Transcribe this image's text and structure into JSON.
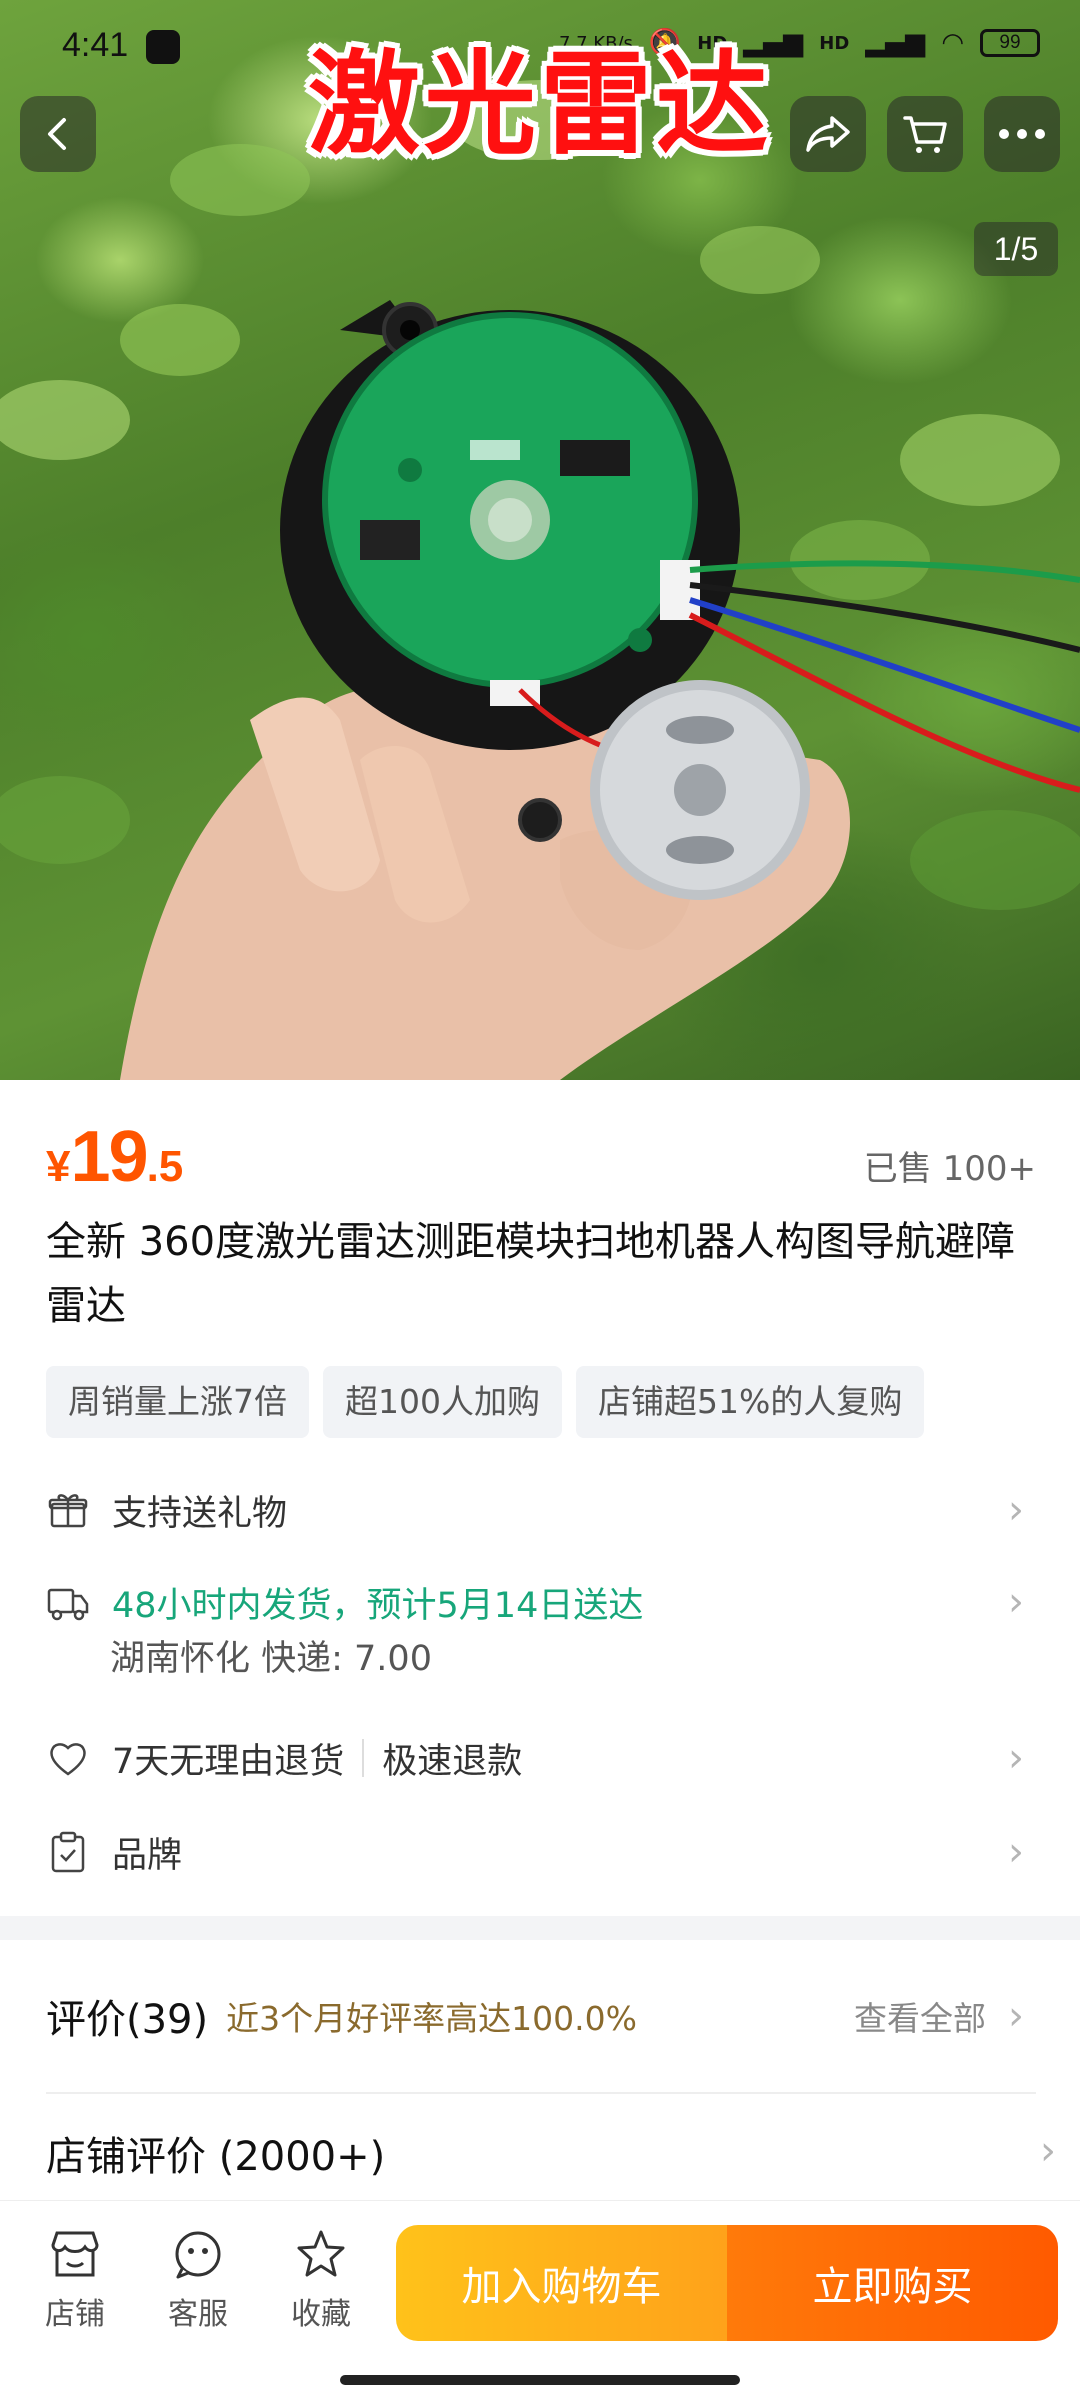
{
  "status_bar": {
    "time": "4:41",
    "battery": "99",
    "network_speed": "7.7 KB/s",
    "signal_labels": [
      "HD",
      "HD"
    ]
  },
  "hero": {
    "overlay_title": "激光雷达",
    "image_counter": "1/5",
    "image_subject": "laser-radar-module-in-hand"
  },
  "product": {
    "price_currency": "¥",
    "price_integer": "19",
    "price_decimal": ".5",
    "sold": "已售 100+",
    "title": "全新 360度激光雷达测距模块扫地机器人构图导航避障雷达",
    "tags": [
      "周销量上涨7倍",
      "超100人加购",
      "店铺超51%的人复购"
    ]
  },
  "services": {
    "gift": "支持送礼物",
    "shipping": "48小时内发货，预计5月14日送达",
    "shipping_detail": "湖南怀化  快递: 7.00",
    "return_policy": "7天无理由退货",
    "refund": "极速退款",
    "brand": "品牌"
  },
  "reviews": {
    "title": "评价(39)",
    "rate": "近3个月好评率高达100.0%",
    "view_all": "查看全部",
    "store_reviews": "店铺评价 (2000+)"
  },
  "bottom_bar": {
    "shop": "店铺",
    "service": "客服",
    "favorite": "收藏",
    "add_to_cart": "加入购物车",
    "buy_now": "立即购买"
  },
  "colors": {
    "price": "#ff5500",
    "shipping_green": "#17a67a",
    "cart_button": "#ffb21a",
    "buy_button": "#ff6a00",
    "hero_title_red": "#ff1010"
  }
}
